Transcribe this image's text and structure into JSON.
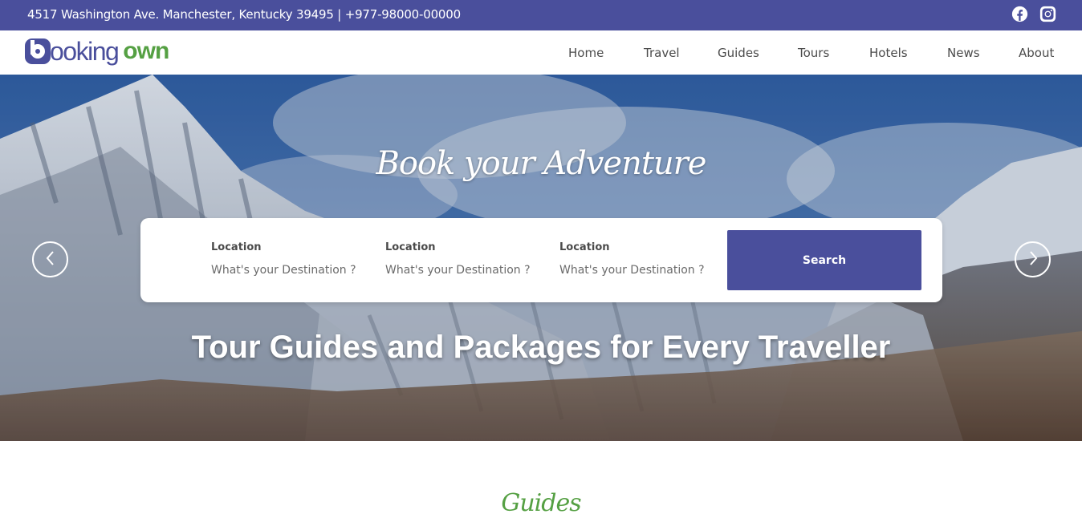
{
  "topbar": {
    "address": "4517 Washington Ave. Manchester, Kentucky 39495 | +977-98000-00000",
    "social": [
      "facebook-icon",
      "instagram-icon"
    ]
  },
  "brand": {
    "part1": "ooking",
    "part2": "own",
    "colors": {
      "primary": "#4a4f9c",
      "accent": "#55a043"
    }
  },
  "nav": {
    "items": [
      "Home",
      "Travel",
      "Guides",
      "Tours",
      "Hotels",
      "News",
      "About"
    ]
  },
  "hero": {
    "script_title": "Book your Adventure",
    "tagline": "Tour Guides and Packages for Every Traveller",
    "fields": [
      {
        "label": "Location",
        "placeholder": "What's your Destination ?"
      },
      {
        "label": "Location",
        "placeholder": "What's your Destination ?"
      },
      {
        "label": "Location",
        "placeholder": "What's your Destination ?"
      }
    ],
    "search_label": "Search",
    "prev_icon": "chevron-left-icon",
    "next_icon": "chevron-right-icon"
  },
  "section": {
    "script_title": "Guides"
  }
}
